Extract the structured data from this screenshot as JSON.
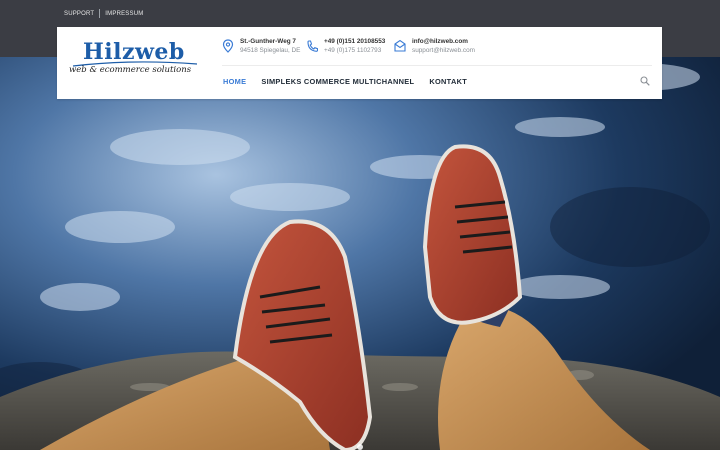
{
  "topbar": {
    "links": [
      "SUPPORT",
      "IMPRESSUM"
    ]
  },
  "logo": {
    "main": "Hilzweb",
    "tagline": "web & ecommerce solutions"
  },
  "contacts": [
    {
      "icon": "location-pin-icon",
      "line1": "St.-Gunther-Weg 7",
      "line2": "94518 Spiegelau, DE"
    },
    {
      "icon": "phone-icon",
      "line1": "+49 (0)151 20108553",
      "line2": "+49 (0)175 1102793"
    },
    {
      "icon": "envelope-icon",
      "line1": "info@hilzweb.com",
      "line2": "support@hilzweb.com"
    }
  ],
  "nav": {
    "items": [
      "HOME",
      "SIMPLEKS COMMERCE MULTICHANNEL",
      "KONTAKT"
    ],
    "active_index": 0
  },
  "colors": {
    "accent": "#3a7bd5",
    "logo_blue": "#1d5da8",
    "topbar": "#3b3d44"
  }
}
